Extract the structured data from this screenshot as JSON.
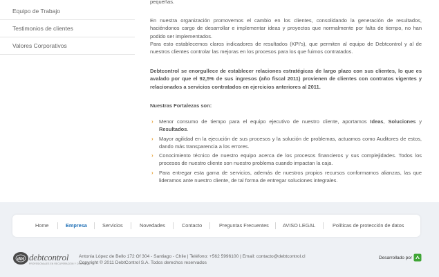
{
  "sidebar": {
    "items": [
      {
        "label": "Equipo de Trabajo"
      },
      {
        "label": "Testimonios de clientes"
      },
      {
        "label": "Valores Corporativos"
      }
    ]
  },
  "main": {
    "top_fragment": "pequeñas.",
    "p1": "En nuestra organización promovemos el cambio en los clientes, consolidando la generación de resultados, haciéndonos cargo de desarrollar e implementar ideas y proyectos que normalmente por falta de tiempo, no han podido ser implementados.",
    "p2": "Para esto establecemos claros indicadores de resultados (KPI's), que permiten al equipo de Debtcontrol y al de nuestros clientes controlar las mejoras en los procesos para los que fuimos contratados.",
    "bold_para": "Debtcontrol se enorgullece de establecer relaciones estratégicas de largo plazo con sus clientes, lo que es avalado por que el 92,5% de sus ingresos (año fiscal 2011) provienen de clientes con contratos vigentes y relacionados a servicios contratados en ejercicios anteriores al 2011.",
    "strengths_heading": "Nuestras Fortalezas son:",
    "strengths": [
      {
        "pre": "Menor consumo de tiempo para el equipo ejecutivo de nuestro cliente, aportamos ",
        "b1": "Ideas",
        "sep1": ", ",
        "b2": "Soluciones",
        "sep2": " y ",
        "b3": "Resultados",
        "post": "."
      },
      {
        "text": "Mayor agilidad en la ejecución de sus procesos y la solución de problemas, actuamos como Auditores de estos, dando más transparencia a los errores."
      },
      {
        "text": "Conocimiento técnico de nuestro equipo acerca de los procesos financieros y sus complejidades. Todos los procesos de nuestro cliente son nuestro problema cuando impactan la caja."
      },
      {
        "text": "Para entregar esta gama de servicios, además de nuestros propios recursos conformamos alianzas, las que lideramos ante nuestro cliente, de tal forma de entregar soluciones integrales."
      }
    ]
  },
  "footer_nav": {
    "items": [
      {
        "label": "Home"
      },
      {
        "label": "Empresa"
      },
      {
        "label": "Servicios"
      },
      {
        "label": "Novedades"
      },
      {
        "label": "Contacto"
      },
      {
        "label": "Preguntas Frecuentes"
      },
      {
        "label": "AVISO LEGAL"
      },
      {
        "label": "Políticas de protección de datos"
      }
    ],
    "active": "Empresa"
  },
  "footer": {
    "logo_icon_text": "dbt",
    "logo_text": "debtcontrol",
    "logo_tagline": "PROFESIONALES EN RECUPERACIÓN Y COBRANZA",
    "address_line1": "Antonia López de Bello 172 Of 304 - Santiago - Chile | Teléfono: +562 5996100 | Email: contacto@debtcontrol.cl",
    "address_line2": "Copyright © 2011 DebtControl S.A. Todos derechos reservados",
    "developed_by": "Desarrollado por"
  },
  "colors": {
    "accent_link": "#1e6fb5",
    "bullet": "#e8a33a",
    "page_bg": "#eef1f5",
    "dev_icon_green": "#3fa535"
  },
  "icons": {
    "bullet": "chevron-right-icon",
    "logo": "debtcontrol-logo",
    "developer": "developer-logo-icon"
  }
}
